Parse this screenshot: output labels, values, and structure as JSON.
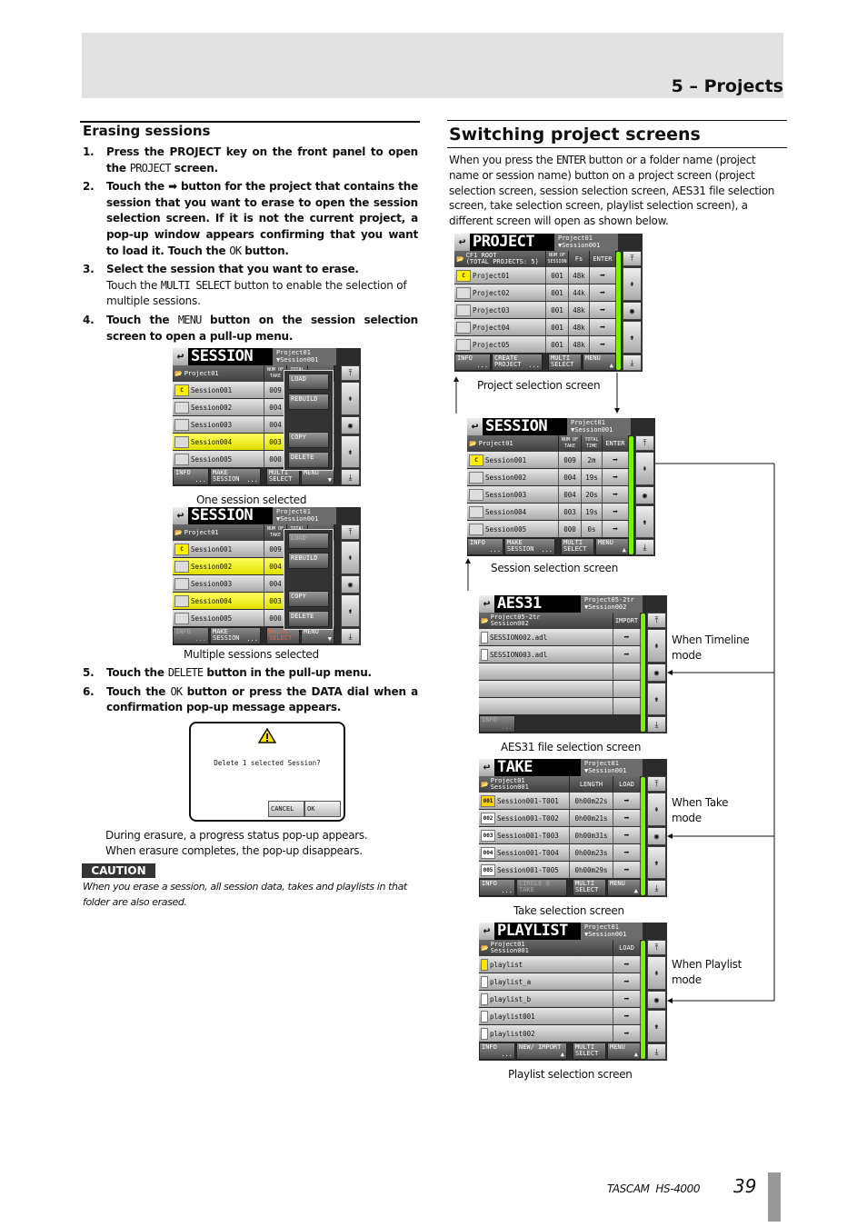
{
  "header": {
    "chapter": "5 – Projects"
  },
  "left": {
    "heading": "Erasing sessions",
    "steps_a": [
      {
        "num": "1.",
        "bold": [
          {
            "t": "Press the PROJECT key on the front panel to open the "
          },
          {
            "t": "PROJECT",
            "lcd": true
          },
          {
            "t": " screen."
          }
        ]
      },
      {
        "num": "2.",
        "bold": [
          {
            "t": "Touch the "
          },
          {
            "icon": "right-arrow-icon",
            "t": "➡"
          },
          {
            "t": " button for the project that contains the session that you want to erase to open the session selection screen. If it is not the current project, a pop-up window appears confirming that you want to load it. Touch the "
          },
          {
            "t": "OK",
            "lcd": true
          },
          {
            "t": " button."
          }
        ]
      },
      {
        "num": "3.",
        "bold": [
          {
            "t": "Select the session that you want to erase."
          }
        ],
        "normal": [
          {
            "t": "Touch the "
          },
          {
            "t": "MULTI SELECT",
            "lcd": true
          },
          {
            "t": " button to enable the selection of multiple sessions."
          }
        ]
      },
      {
        "num": "4.",
        "bold": [
          {
            "t": "Touch the "
          },
          {
            "t": "MENU",
            "lcd": true
          },
          {
            "t": " button on the session selection screen to open a pull-up menu."
          }
        ]
      }
    ],
    "steps_b": [
      {
        "num": "5.",
        "bold": [
          {
            "t": "Touch the "
          },
          {
            "t": "DELETE",
            "lcd": true
          },
          {
            "t": " button in the pull-up menu."
          }
        ]
      },
      {
        "num": "6.",
        "bold": [
          {
            "t": "Touch the "
          },
          {
            "t": "OK",
            "lcd": true
          },
          {
            "t": " button or press the DATA dial when a confirmation pop-up message appears."
          }
        ]
      }
    ],
    "caption_one": "One session selected",
    "caption_multi": "Multiple sessions selected",
    "dialog": {
      "icon": "warning-icon",
      "message": "Delete 1 selected Session?",
      "cancel": "CANCEL",
      "ok": "OK"
    },
    "after_lines": [
      "During erasure, a progress status pop-up appears.",
      "When erasure completes, the pop-up disappears."
    ],
    "caution_label": "CAUTION",
    "caution_text": "When you erase a session, all session data, takes and playlists in that folder are also erased."
  },
  "right": {
    "heading": "Switching project screens",
    "intro": [
      {
        "t": "When you press the "
      },
      {
        "t": "ENTER",
        "lcd": true
      },
      {
        "t": " button or a folder name (project name or session name) button on a project screen (project selection screen, session selection screen, AES31 file selection screen, take selection screen, playlist selection screen), a different screen will open as shown below."
      }
    ],
    "captions": {
      "project": "Project selection screen",
      "session": "Session selection screen",
      "aes31": "AES31 file selection screen",
      "take": "Take selection screen",
      "playlist": "Playlist selection screen"
    },
    "modes": {
      "timeline": [
        "When Timeline",
        "mode"
      ],
      "take": [
        "When Take",
        "mode"
      ],
      "playlist": [
        "When Playlist",
        "mode"
      ]
    }
  },
  "screens": {
    "session_one": {
      "title": "SESSION",
      "sub": [
        "Project01",
        "▼Session001"
      ],
      "head": [
        "Project01",
        ""
      ],
      "cols": [
        "NUM OF TAKE",
        "TOTAL TIME",
        ""
      ],
      "rows": [
        {
          "badge": "C",
          "name": "Session001",
          "cells": [
            "009",
            "2"
          ]
        },
        {
          "name": "Session002",
          "cells": [
            "004",
            "19"
          ]
        },
        {
          "name": "Session003",
          "cells": [
            "004",
            "20"
          ]
        },
        {
          "name": "Session004",
          "cells": [
            "003",
            "19"
          ],
          "selected": true
        },
        {
          "name": "Session005",
          "cells": [
            "000",
            "0"
          ]
        }
      ],
      "buttons": [
        {
          "label": "INFO",
          "sub": "..."
        },
        {
          "label": "MAKE SESSION",
          "sub": "..."
        },
        {
          "label": "MULTI SELECT"
        },
        {
          "label": "MENU",
          "sub": "▼"
        }
      ],
      "menu": [
        {
          "label": "LOAD"
        },
        {
          "label": "REBUILD"
        },
        {
          "label": "COPY"
        },
        {
          "label": "DELETE"
        }
      ]
    },
    "session_multi": {
      "title": "SESSION",
      "sub": [
        "Project01",
        "▼Session001"
      ],
      "head": [
        "Project01",
        ""
      ],
      "cols": [
        "NUM OF TAKE",
        "TOTAL TIME",
        ""
      ],
      "rows": [
        {
          "badge": "C",
          "name": "Session001",
          "cells": [
            "009",
            "2"
          ]
        },
        {
          "name": "Session002",
          "cells": [
            "004",
            "19"
          ],
          "selected": true
        },
        {
          "name": "Session003",
          "cells": [
            "004",
            "20"
          ]
        },
        {
          "name": "Session004",
          "cells": [
            "003",
            "19"
          ],
          "selected": true
        },
        {
          "name": "Session005",
          "cells": [
            "000",
            "0"
          ]
        }
      ],
      "buttons": [
        {
          "label": "INFO",
          "sub": "...",
          "disabled": true
        },
        {
          "label": "MAKE SESSION",
          "sub": "..."
        },
        {
          "label": "MULTI SELECT",
          "active": true
        },
        {
          "label": "MENU",
          "sub": "▼"
        }
      ],
      "menu": [
        {
          "label": "LOAD",
          "disabled": true
        },
        {
          "label": "REBUILD"
        },
        {
          "label": "COPY"
        },
        {
          "label": "DELETE"
        }
      ]
    },
    "project": {
      "title": "PROJECT",
      "sub": [
        "Project01",
        "▼Session001"
      ],
      "head": [
        "CF1 ROOT",
        "(TOTAL PROJECTS: 5)"
      ],
      "cols": [
        "NUM OF SESSION",
        "Fs",
        "ENTER"
      ],
      "rows": [
        {
          "badge": "C",
          "name": "Project01",
          "cells": [
            "001",
            "48k"
          ],
          "arrow": true
        },
        {
          "name": "Project02",
          "cells": [
            "001",
            "44k"
          ],
          "arrow": true
        },
        {
          "name": "Project03",
          "cells": [
            "001",
            "48k"
          ],
          "arrow": true
        },
        {
          "name": "Project04",
          "cells": [
            "001",
            "48k"
          ],
          "arrow": true
        },
        {
          "name": "Project05",
          "cells": [
            "001",
            "48k"
          ],
          "arrow": true
        }
      ],
      "buttons": [
        {
          "label": "INFO",
          "sub": "..."
        },
        {
          "label": "CREATE PROJECT",
          "sub": "..."
        },
        {
          "label": "MULTI SELECT"
        },
        {
          "label": "MENU",
          "sub": "▲"
        }
      ]
    },
    "session": {
      "title": "SESSION",
      "sub": [
        "Project01",
        "▼Session001"
      ],
      "head": [
        "Project01",
        ""
      ],
      "cols": [
        "NUM OF TAKE",
        "TOTAL TIME",
        "ENTER"
      ],
      "rows": [
        {
          "badge": "C",
          "name": "Session001",
          "cells": [
            "009",
            "2m"
          ],
          "arrow": true
        },
        {
          "name": "Session002",
          "cells": [
            "004",
            "19s"
          ],
          "arrow": true
        },
        {
          "name": "Session003",
          "cells": [
            "004",
            "20s"
          ],
          "arrow": true
        },
        {
          "name": "Session004",
          "cells": [
            "003",
            "19s"
          ],
          "arrow": true
        },
        {
          "name": "Session005",
          "cells": [
            "000",
            "0s"
          ],
          "arrow": true
        }
      ],
      "buttons": [
        {
          "label": "INFO",
          "sub": "..."
        },
        {
          "label": "MAKE SESSION",
          "sub": "..."
        },
        {
          "label": "MULTI SELECT"
        },
        {
          "label": "MENU",
          "sub": "▲"
        }
      ]
    },
    "aes31": {
      "title": "AES31",
      "sub": [
        "Project05-2tr",
        "▼Session002"
      ],
      "head": [
        "Project05-2tr",
        "Session002"
      ],
      "cols": [
        "IMPORT"
      ],
      "rows": [
        {
          "file": true,
          "name": "SESSION002.adl",
          "arrow": true
        },
        {
          "file": true,
          "name": "SESSION003.adl",
          "arrow": true
        },
        {
          "name": ""
        },
        {
          "name": ""
        },
        {
          "name": ""
        }
      ],
      "buttons": [
        {
          "label": "INFO",
          "sub": "...",
          "disabled": true
        }
      ]
    },
    "take": {
      "title": "TAKE",
      "sub": [
        "Project01",
        "▼Session001"
      ],
      "head": [
        "Project01",
        "Session001"
      ],
      "cols": [
        "LENGTH",
        "LOAD"
      ],
      "rows": [
        {
          "badge": "001",
          "current": true,
          "name": "Session001-T001",
          "cells": [
            "0h00m22s"
          ],
          "arrow": true
        },
        {
          "badge": "002",
          "name": "Session001-T002",
          "cells": [
            "0h00m21s"
          ],
          "arrow": true
        },
        {
          "badge": "003",
          "name": "Session001-T003",
          "cells": [
            "0h00m31s"
          ],
          "arrow": true
        },
        {
          "badge": "004",
          "name": "Session001-T004",
          "cells": [
            "0h00m23s"
          ],
          "arrow": true
        },
        {
          "badge": "005",
          "name": "Session001-T005",
          "cells": [
            "0h00m29s"
          ],
          "arrow": true
        }
      ],
      "buttons": [
        {
          "label": "INFO",
          "sub": "..."
        },
        {
          "label": "CIRCLE @ TAKE",
          "disabled": true
        },
        {
          "label": "MULTI SELECT"
        },
        {
          "label": "MENU",
          "sub": "▲"
        }
      ]
    },
    "playlist": {
      "title": "PLAYLIST",
      "sub": [
        "Project01",
        "▼Session001"
      ],
      "head": [
        "Project01",
        "Session001"
      ],
      "cols": [
        "LOAD"
      ],
      "rows": [
        {
          "file": true,
          "current": true,
          "name": "playlist",
          "arrow": true
        },
        {
          "file": true,
          "name": "playlist_a",
          "arrow": true
        },
        {
          "file": true,
          "name": "playlist_b",
          "arrow": true
        },
        {
          "file": true,
          "name": "playlist001",
          "arrow": true
        },
        {
          "file": true,
          "name": "playlist002",
          "arrow": true
        }
      ],
      "buttons": [
        {
          "label": "INFO",
          "sub": "..."
        },
        {
          "label": "NEW/ IMPORT",
          "sub": "▲"
        },
        {
          "label": "MULTI SELECT"
        },
        {
          "label": "MENU",
          "sub": "▲"
        }
      ]
    }
  },
  "footer": {
    "brand": "TASCAM  HS-4000",
    "page": "39"
  },
  "colors": {
    "selected_row": "#f0f000",
    "green_bar": "#7cf000",
    "multi_select_active": "#ff5a3c"
  }
}
